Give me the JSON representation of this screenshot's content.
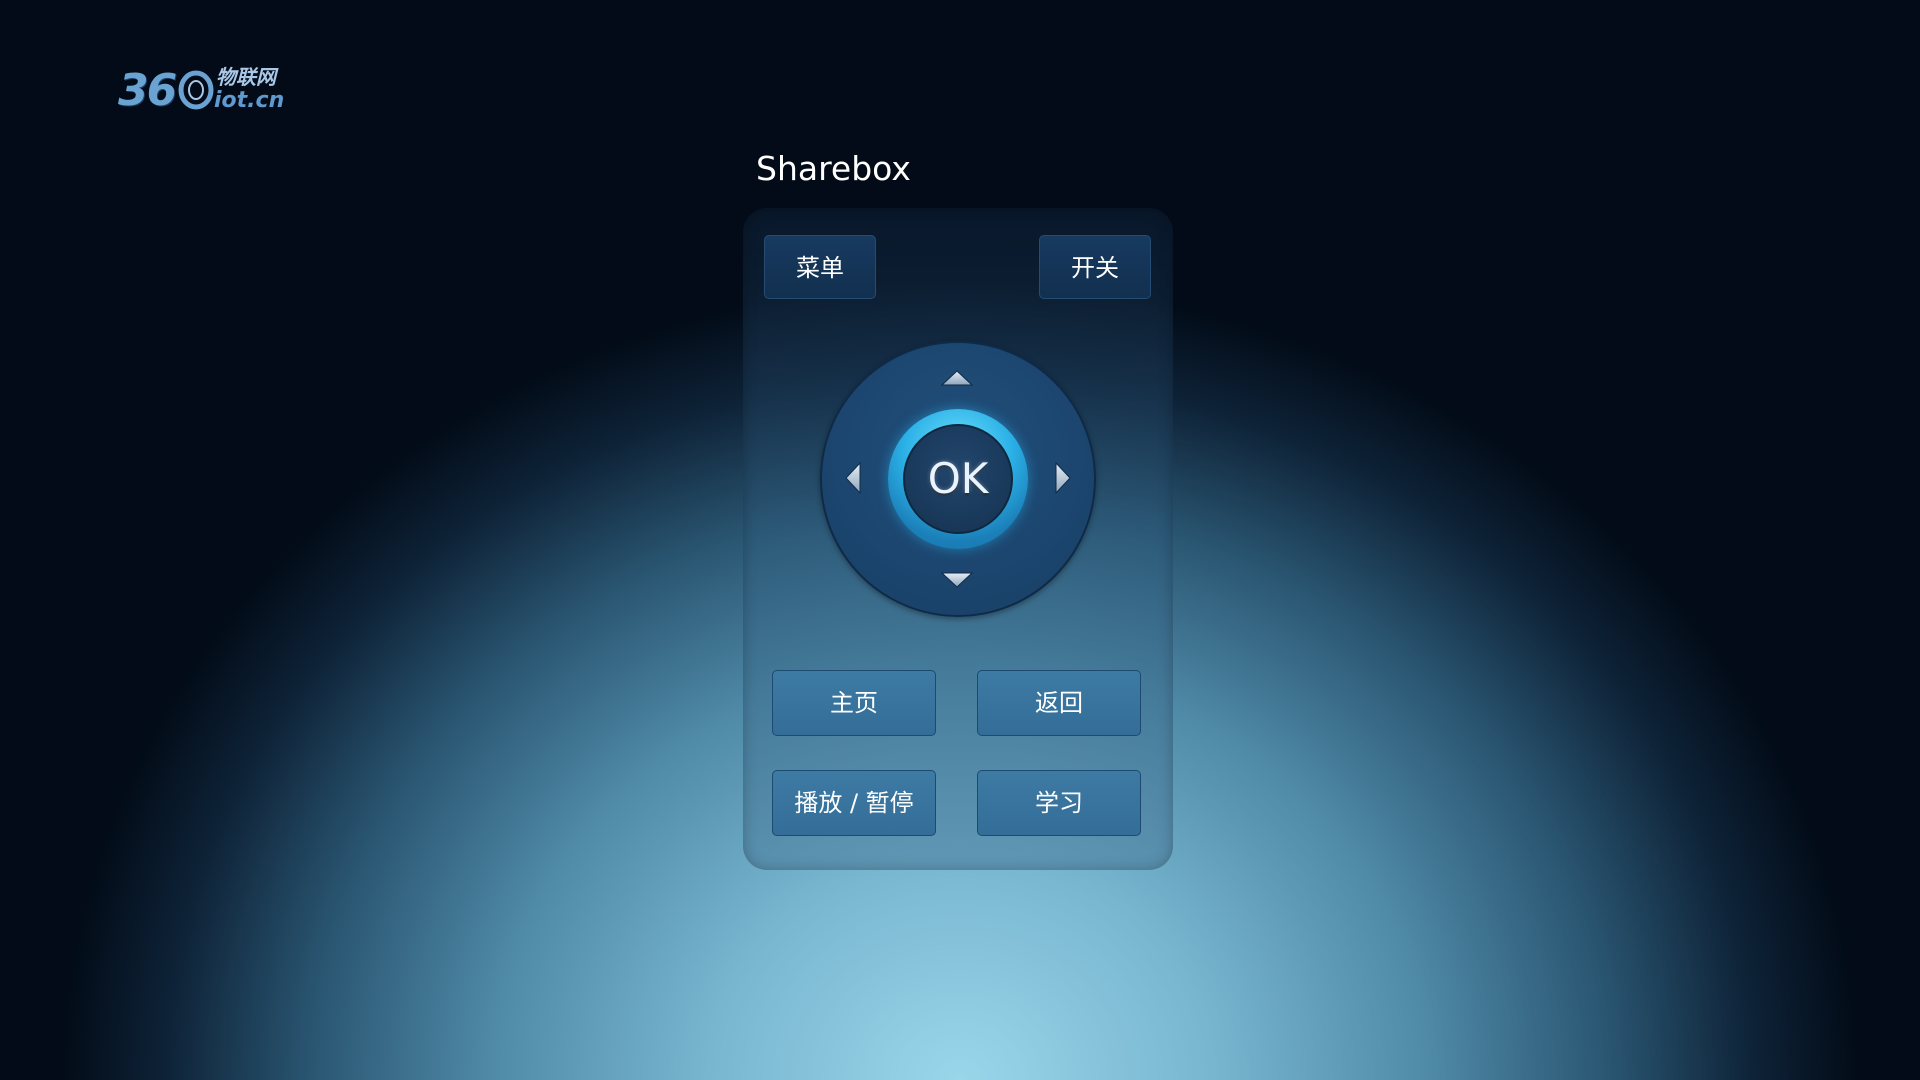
{
  "logo": {
    "number": "36",
    "name_cn": "物联网",
    "domain": "iot.cn"
  },
  "device": {
    "title": "Sharebox"
  },
  "remote": {
    "menu_label": "菜单",
    "power_label": "开关",
    "ok_label": "OK",
    "home_label": "主页",
    "back_label": "返回",
    "play_pause_label": "播放 / 暂停",
    "learn_label": "学习"
  },
  "icons": {
    "up": "arrow-up-icon",
    "down": "arrow-down-icon",
    "left": "arrow-left-icon",
    "right": "arrow-right-icon"
  },
  "colors": {
    "accent": "#2bb0e6",
    "dark_button": "#173a60",
    "light_button": "#3d7aa4",
    "background_top": "#020b17",
    "background_bottom": "#9ad6ea"
  }
}
